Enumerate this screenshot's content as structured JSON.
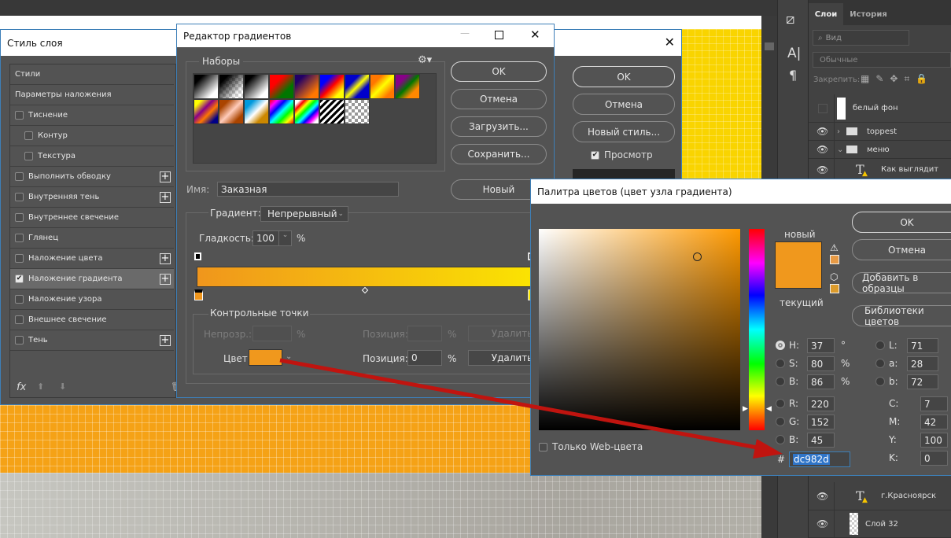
{
  "layer_style": {
    "title": "Стиль слоя",
    "items": [
      {
        "label": "Стили",
        "checkbox": false,
        "indent": false,
        "plus": false,
        "checked": false
      },
      {
        "label": "Параметры наложения",
        "checkbox": false,
        "indent": false,
        "plus": false,
        "checked": false
      },
      {
        "label": "Тиснение",
        "checkbox": true,
        "indent": false,
        "plus": false,
        "checked": false
      },
      {
        "label": "Контур",
        "checkbox": true,
        "indent": true,
        "plus": false,
        "checked": false
      },
      {
        "label": "Текстура",
        "checkbox": true,
        "indent": true,
        "plus": false,
        "checked": false
      },
      {
        "label": "Выполнить обводку",
        "checkbox": true,
        "indent": false,
        "plus": true,
        "checked": false
      },
      {
        "label": "Внутренняя тень",
        "checkbox": true,
        "indent": false,
        "plus": true,
        "checked": false
      },
      {
        "label": "Внутреннее свечение",
        "checkbox": true,
        "indent": false,
        "plus": false,
        "checked": false
      },
      {
        "label": "Глянец",
        "checkbox": true,
        "indent": false,
        "plus": false,
        "checked": false
      },
      {
        "label": "Наложение цвета",
        "checkbox": true,
        "indent": false,
        "plus": true,
        "checked": false
      },
      {
        "label": "Наложение градиента",
        "checkbox": true,
        "indent": false,
        "plus": true,
        "checked": true
      },
      {
        "label": "Наложение узора",
        "checkbox": true,
        "indent": false,
        "plus": false,
        "checked": false
      },
      {
        "label": "Внешнее свечение",
        "checkbox": true,
        "indent": false,
        "plus": false,
        "checked": false
      },
      {
        "label": "Тень",
        "checkbox": true,
        "indent": false,
        "plus": true,
        "checked": false
      }
    ],
    "fx_label": "fx",
    "ok": "OK",
    "cancel": "Отмена",
    "new_style": "Новый стиль...",
    "preview": "Просмотр"
  },
  "gradient_editor": {
    "title": "Редактор градиентов",
    "presets_label": "Наборы",
    "ok": "OK",
    "cancel": "Отмена",
    "load": "Загрузить...",
    "save": "Сохранить...",
    "new": "Новый",
    "name_label": "Имя:",
    "name_value": "Заказная",
    "gradient_label": "Градиент:",
    "gradient_type": "Непрерывный",
    "smoothness_label": "Гладкость:",
    "smoothness_value": "100",
    "percent": "%",
    "gradient_colors": [
      "#f0961c",
      "#fbe800"
    ],
    "stops_label": "Контрольные точки",
    "opacity_label": "Непрозр.:",
    "position_label": "Позиция:",
    "delete": "Удалить",
    "color_label": "Цвет:",
    "color_value": "#f0981d",
    "position_value": "0"
  },
  "color_picker": {
    "title": "Палитра цветов (цвет узла градиента)",
    "new_label": "новый",
    "current_label": "текущий",
    "new_color": "#f0981d",
    "current_color": "#f0981d",
    "ok": "OK",
    "cancel": "Отмена",
    "add_swatch": "Добавить в образцы",
    "libraries": "Библиотеки цветов",
    "web_only": "Только Web-цвета",
    "hsb": [
      {
        "label": "H:",
        "value": "37",
        "unit": "°",
        "selected": true
      },
      {
        "label": "S:",
        "value": "80",
        "unit": "%",
        "selected": false
      },
      {
        "label": "B:",
        "value": "86",
        "unit": "%",
        "selected": false
      }
    ],
    "rgb": [
      {
        "label": "R:",
        "value": "220"
      },
      {
        "label": "G:",
        "value": "152"
      },
      {
        "label": "B:",
        "value": "45"
      }
    ],
    "lab": [
      {
        "label": "L:",
        "value": "71"
      },
      {
        "label": "a:",
        "value": "28"
      },
      {
        "label": "b:",
        "value": "72"
      }
    ],
    "cmyk": [
      {
        "label": "C:",
        "value": "7",
        "unit": "%"
      },
      {
        "label": "M:",
        "value": "42",
        "unit": "%"
      },
      {
        "label": "Y:",
        "value": "100",
        "unit": "%"
      },
      {
        "label": "K:",
        "value": "0",
        "unit": "%"
      }
    ],
    "hex_label": "#",
    "hex_value": "dc982d",
    "hue_color": "#ff9900"
  },
  "layers_panel": {
    "tabs": [
      "Слои",
      "История"
    ],
    "filter_placeholder": "Вид",
    "blend_mode": "Обычные",
    "lock_label": "Закрепить:",
    "layers_top": [
      {
        "name": "белый фон",
        "visible": false,
        "type": "fill"
      },
      {
        "name": "toppest",
        "visible": true,
        "type": "group-closed"
      },
      {
        "name": "меню",
        "visible": true,
        "type": "group-open"
      },
      {
        "name": "Как выглядит",
        "visible": true,
        "type": "text"
      }
    ],
    "layers_bottom": [
      {
        "name": "г.Красноярск",
        "visible": true,
        "type": "text"
      },
      {
        "name": "Слой 32",
        "visible": true,
        "type": "pixel"
      }
    ]
  },
  "accent_arrow_color": "#c0140f"
}
